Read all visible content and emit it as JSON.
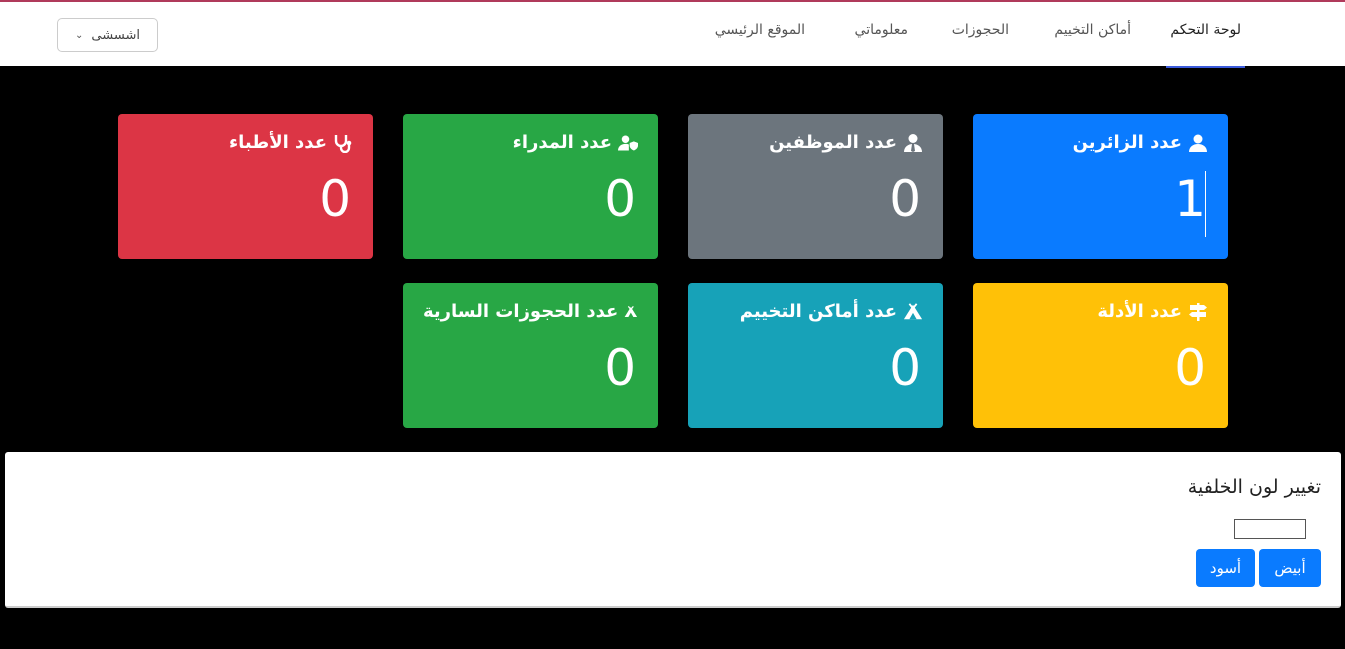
{
  "nav": {
    "items": [
      {
        "label": "لوحة التحكم",
        "active": true
      },
      {
        "label": "أماكن التخييم",
        "active": false
      },
      {
        "label": "الحجوزات",
        "active": false
      },
      {
        "label": "معلوماتي",
        "active": false
      },
      {
        "label": "الموقع الرئيسي",
        "active": false
      }
    ],
    "user_label": "اشسشى"
  },
  "cards": [
    {
      "title": "عدد الزائرين",
      "value": "1",
      "icon": "user-icon",
      "color": "#0a7bff"
    },
    {
      "title": "عدد الموظفين",
      "value": "0",
      "icon": "user-tie-icon",
      "color": "#6c757d"
    },
    {
      "title": "عدد المدراء",
      "value": "0",
      "icon": "user-shield-icon",
      "color": "#28a745"
    },
    {
      "title": "عدد الأطباء",
      "value": "0",
      "icon": "stethoscope-icon",
      "color": "#dc3545"
    },
    {
      "title": "عدد الأدلة",
      "value": "0",
      "icon": "signpost-icon",
      "color": "#ffc107"
    },
    {
      "title": "عدد أماكن التخييم",
      "value": "0",
      "icon": "campground-icon",
      "color": "#17a2b8"
    },
    {
      "title": "عدد الحجوزات السارية",
      "value": "0",
      "icon": "campground-icon",
      "color": "#28a745"
    }
  ],
  "background_panel": {
    "title": "تغيير لون الخلفية",
    "white_button": "أبيض",
    "black_button": "أسود"
  }
}
